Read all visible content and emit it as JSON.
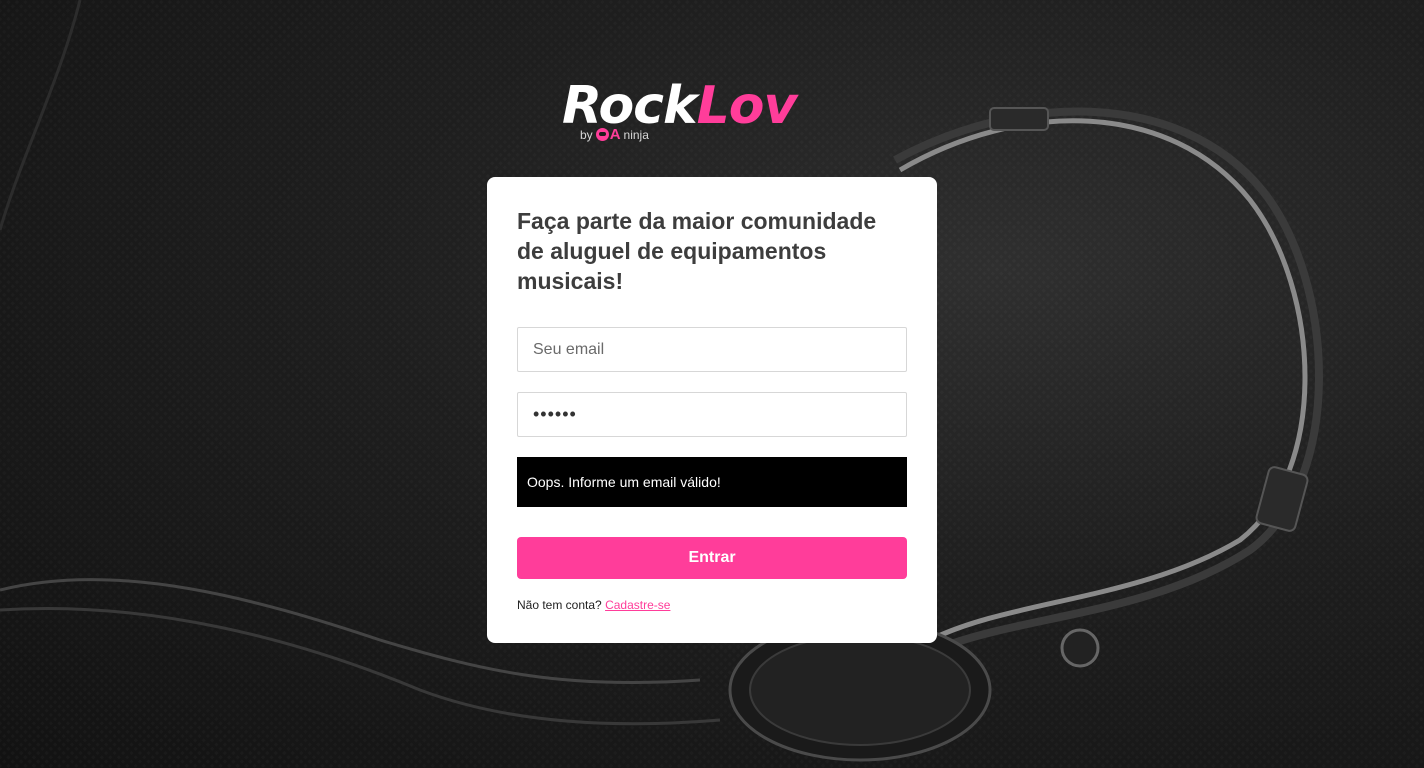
{
  "brand": {
    "name_part1": "Rock",
    "name_part2": "Lov",
    "by": "by",
    "qa": "A",
    "ninja": "ninja",
    "accent_color": "#ff3d9a"
  },
  "login": {
    "headline": "Faça parte da maior comunidade de aluguel de equipamentos musicais!",
    "email_placeholder": "Seu email",
    "email_value": "",
    "password_value": "••••••",
    "alert_message": "Oops. Informe um email válido!",
    "submit_label": "Entrar",
    "no_account_text": "Não tem conta?",
    "signup_link": "Cadastre-se"
  },
  "background": {
    "description_icon": "headphones-icon"
  }
}
